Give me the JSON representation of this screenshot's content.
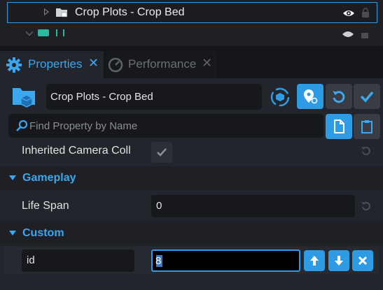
{
  "hierarchy": {
    "selected_label": "Crop Plots - Crop Bed"
  },
  "tabs": [
    {
      "label": "Properties",
      "close": "✕"
    },
    {
      "label": "Performance",
      "close": "✕"
    }
  ],
  "object": {
    "name": "Crop Plots - Crop Bed"
  },
  "search": {
    "placeholder": "Find Property by Name",
    "value": ""
  },
  "properties": {
    "inherited_camera_label": "Inherited Camera Coll",
    "gameplay_section": "Gameplay",
    "life_span_label": "Life Span",
    "life_span_value": "0",
    "custom_section": "Custom",
    "custom_id_name": "id",
    "custom_id_value": "8"
  },
  "colors": {
    "accent": "#2e9ce4",
    "background": "#22252b"
  }
}
